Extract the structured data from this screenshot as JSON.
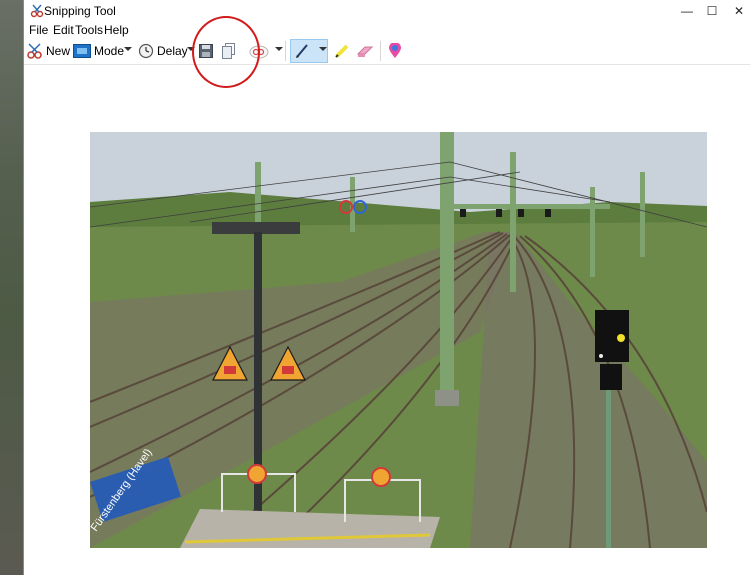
{
  "window": {
    "title": "Snipping Tool"
  },
  "window_controls": {
    "minimize": "—",
    "maximize": "☐",
    "close": "✕"
  },
  "menu": {
    "items": [
      "File",
      "Edit",
      "Tools",
      "Help"
    ]
  },
  "toolbar": {
    "new_label": "New",
    "mode_label": "Mode",
    "delay_label": "Delay"
  },
  "snip": {
    "station_sign": "Fürstenberg (Havel)"
  },
  "colors": {
    "annotation_circle": "#d21a1a",
    "sky": "#c9d2db",
    "grass": "#6e8a4a",
    "signal_light": "#f2e12a",
    "catenary_mast": "#7fa36f",
    "station_sign": "#2a5db0"
  }
}
